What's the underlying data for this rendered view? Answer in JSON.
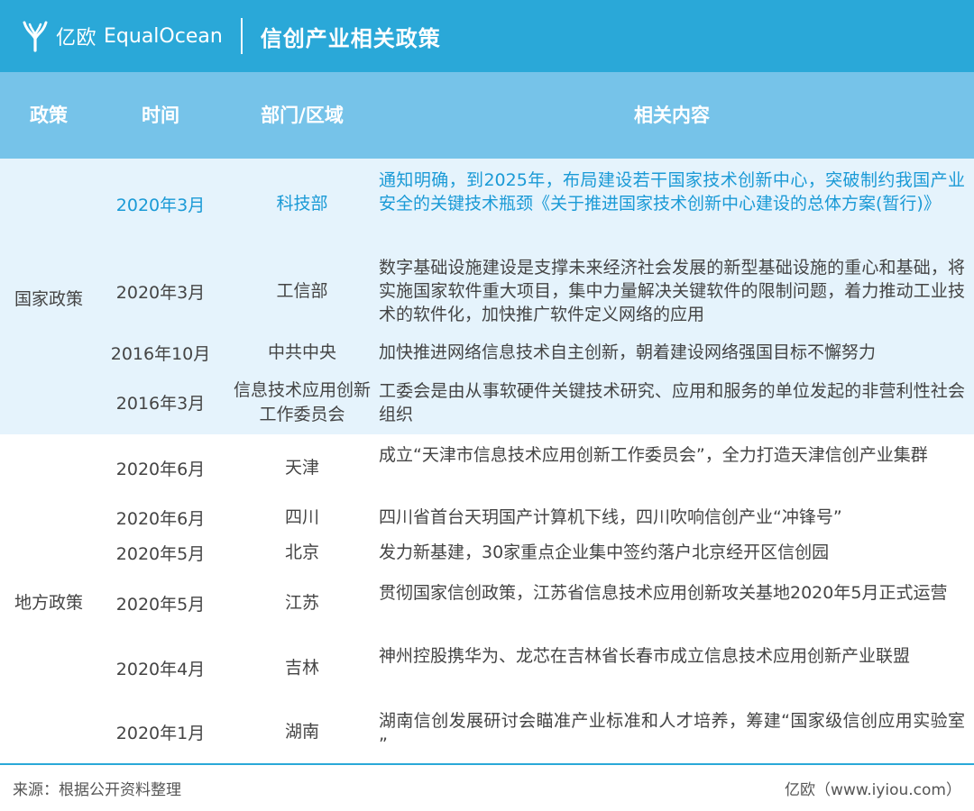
{
  "header": {
    "logo_cn": "亿欧",
    "logo_en": "EqualOcean",
    "title": "信创产业相关政策",
    "bg_color": "#2aa8d8"
  },
  "columns": {
    "policy": "政策",
    "time": "时间",
    "dept": "部门/区域",
    "content": "相关内容"
  },
  "groups": {
    "national": "国家政策",
    "local": "地方政策"
  },
  "rows": [
    {
      "time": "2020年3月",
      "dept": "科技部",
      "content": "通知明确，到2025年，布局建设若干国家技术创新中心，突破制约我国产业安全的关键技术瓶颈《关于推进国家技术创新中心建设的总体方案(暂行)》"
    },
    {
      "time": "2020年3月",
      "dept": "工信部",
      "content": "数字基础设施建设是支撑未来经济社会发展的新型基础设施的重心和基础，将实施国家软件重大项目，集中力量解决关键软件的限制问题，着力推动工业技术的软件化，加快推广软件定义网络的应用"
    },
    {
      "time": "2016年10月",
      "dept": "中共中央",
      "content": "加快推进网络信息技术自主创新，朝着建设网络强国目标不懈努力"
    },
    {
      "time": "2016年3月",
      "dept": "信息技术应用创新工作委员会",
      "content": "工委会是由从事软硬件关键技术研究、应用和服务的单位发起的非营利性社会组织"
    },
    {
      "time": "2020年6月",
      "dept": "天津",
      "content": "成立“天津市信息技术应用创新工作委员会”，全力打造天津信创产业集群"
    },
    {
      "time": "2020年6月",
      "dept": "四川",
      "content": "四川省首台天玥国产计算机下线，四川吹响信创产业“冲锋号”"
    },
    {
      "time": "2020年5月",
      "dept": "北京",
      "content": "发力新基建，30家重点企业集中签约落户北京经开区信创园"
    },
    {
      "time": "2020年5月",
      "dept": "江苏",
      "content": "贯彻国家信创政策，江苏省信息技术应用创新攻关基地2020年5月正式运营"
    },
    {
      "time": "2020年4月",
      "dept": "吉林",
      "content": "神州控股携华为、龙芯在吉林省长春市成立信息技术应用创新产业联盟"
    },
    {
      "time": "2020年1月",
      "dept": "湖南",
      "content": "湖南信创发展研讨会瞄准产业标准和人才培养，筹建“国家级信创应用实验室 ”"
    }
  ],
  "footer": {
    "source": "来源：根据公开资料整理",
    "credit": "亿欧（www.iyiou.com）"
  }
}
